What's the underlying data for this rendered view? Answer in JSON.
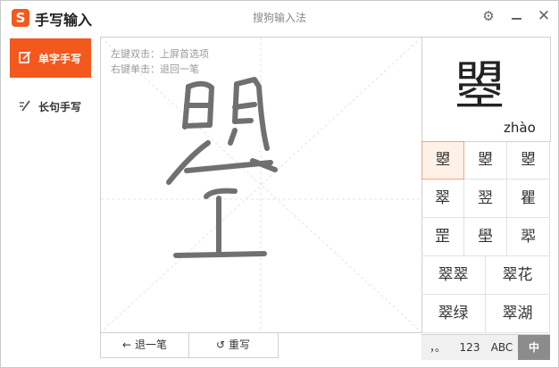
{
  "window": {
    "title": "手写输入",
    "ime_name": "搜狗输入法",
    "logo_letter": "S",
    "accent_color": "#f3581d"
  },
  "sidebar": {
    "modes": [
      {
        "label": "单字手写",
        "active": true
      },
      {
        "label": "长句手写",
        "active": false
      }
    ]
  },
  "canvas": {
    "hints": [
      "左键双击：上屏首选项",
      "右键单击：退回一笔"
    ]
  },
  "actions": {
    "back_label": "退一笔",
    "back_icon": "←",
    "rewrite_label": "重写",
    "rewrite_icon": "↺"
  },
  "preview": {
    "char": "曌",
    "pinyin": "zhào"
  },
  "candidates": {
    "singles": [
      "曌",
      "曌",
      "曌",
      "翠",
      "翌",
      "瞿",
      "罡",
      "壆",
      "翆"
    ],
    "words": [
      "翠翠",
      "翠花",
      "翠绿",
      "翠湖"
    ]
  },
  "tools": [
    {
      "label": "，。",
      "active": false
    },
    {
      "label": "123",
      "active": false
    },
    {
      "label": "ABC",
      "active": false
    },
    {
      "label": "中",
      "active": true
    }
  ]
}
